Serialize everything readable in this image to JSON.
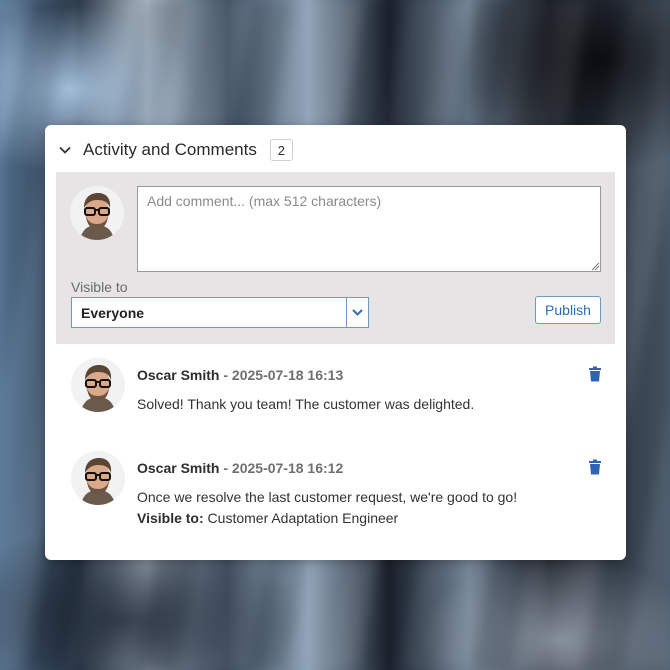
{
  "section": {
    "title": "Activity and Comments",
    "count": "2"
  },
  "composer": {
    "placeholder": "Add comment... (max 512 characters)",
    "visible_label": "Visible to",
    "visible_value": "Everyone",
    "publish_label": "Publish"
  },
  "comments": [
    {
      "author": "Oscar Smith",
      "date": " - 2025-07-18 16:13",
      "text": "Solved! Thank you team! The customer was delighted."
    },
    {
      "author": "Oscar Smith",
      "date": " - 2025-07-18 16:12",
      "text": "Once we resolve the last customer request, we're good to go!",
      "visible_label": "Visible to:",
      "visible_value": " Customer Adaptation Engineer"
    }
  ],
  "icons": {
    "collapse": "chevron-down-icon",
    "dropdown": "chevron-down-icon",
    "delete": "trash-icon"
  },
  "colors": {
    "accent": "#2e6bb0",
    "composer_bg": "#e6e4e5",
    "trash": "#2f64b4"
  }
}
